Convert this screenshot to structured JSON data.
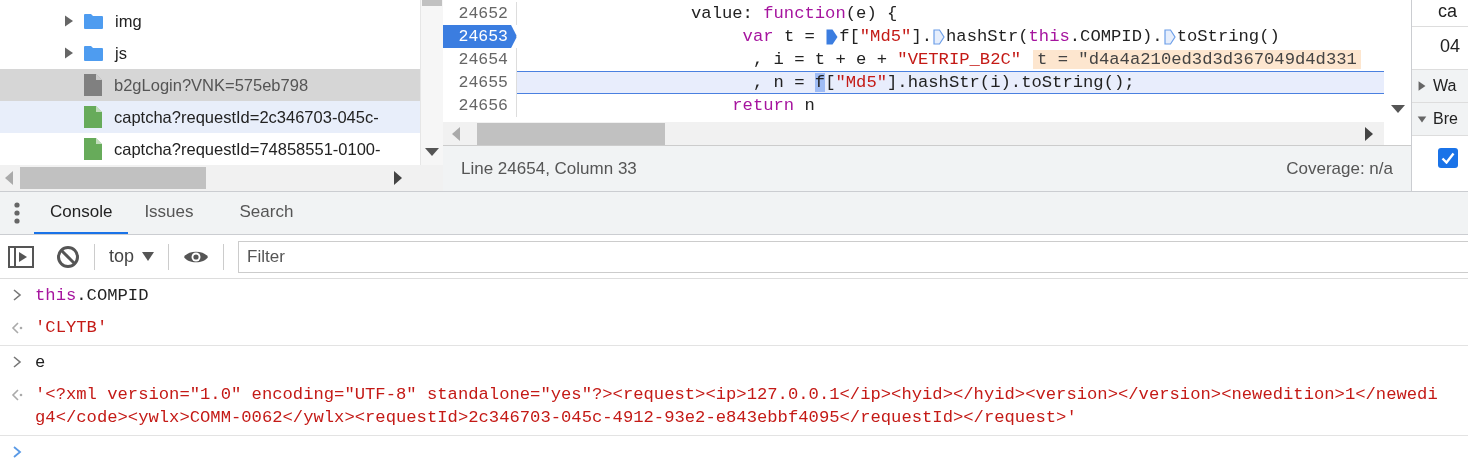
{
  "file_tree": {
    "items": [
      {
        "kind": "folder",
        "name": "img",
        "expanded": false,
        "selected": false,
        "hovered": false
      },
      {
        "kind": "folder",
        "name": "js",
        "expanded": false,
        "selected": false,
        "hovered": false
      },
      {
        "kind": "file",
        "name": "b2gLogin?VNK=575eb798",
        "color": "#808080",
        "selected": true,
        "hovered": false
      },
      {
        "kind": "file",
        "name": "captcha?requestId=2c346703-045c-",
        "color": "#67ab5a",
        "selected": false,
        "hovered": true
      },
      {
        "kind": "file",
        "name": "captcha?requestId=74858551-0100-",
        "color": "#67ab5a",
        "selected": false,
        "hovered": false
      }
    ]
  },
  "editor": {
    "lines": [
      {
        "number": "24652",
        "paused": false,
        "current": false,
        "tokens": [
          {
            "kind": "plain",
            "text": "                value: "
          },
          {
            "kind": "keyword",
            "text": "function"
          },
          {
            "kind": "plain",
            "text": "(e) {"
          }
        ]
      },
      {
        "number": "24653",
        "paused": true,
        "current": false,
        "tokens": [
          {
            "kind": "keyword",
            "text": "                     var"
          },
          {
            "kind": "plain",
            "text": " t = "
          },
          {
            "kind": "marker",
            "active": true
          },
          {
            "kind": "plain",
            "text": "f["
          },
          {
            "kind": "string",
            "text": "\"Md5\""
          },
          {
            "kind": "plain",
            "text": "]."
          },
          {
            "kind": "marker",
            "active": false
          },
          {
            "kind": "plain",
            "text": "hashStr("
          },
          {
            "kind": "keyword",
            "text": "this"
          },
          {
            "kind": "plain",
            "text": ".COMPID)."
          },
          {
            "kind": "marker",
            "active": false
          },
          {
            "kind": "plain",
            "text": "toString()"
          }
        ]
      },
      {
        "number": "24654",
        "paused": false,
        "current": false,
        "tokens": [
          {
            "kind": "plain",
            "text": "                      , i = t + e + "
          },
          {
            "kind": "string",
            "text": "\"VETRIP_B2C\""
          },
          {
            "kind": "inline-value",
            "text": "t = \"d4a4a210ed3d3d367049d4d331"
          }
        ]
      },
      {
        "number": "24655",
        "paused": false,
        "current": true,
        "tokens": [
          {
            "kind": "plain",
            "text": "                      , n = "
          },
          {
            "kind": "selection",
            "text": "f"
          },
          {
            "kind": "plain",
            "text": "["
          },
          {
            "kind": "string",
            "text": "\"Md5\""
          },
          {
            "kind": "plain",
            "text": "].hashStr(i).toString();"
          }
        ]
      },
      {
        "number": "24656",
        "paused": false,
        "current": false,
        "tokens": [
          {
            "kind": "keyword",
            "text": "                    return"
          },
          {
            "kind": "plain",
            "text": " n"
          }
        ]
      }
    ],
    "status": {
      "position": "Line 24654, Column 33",
      "coverage": "Coverage: n/a"
    }
  },
  "sidebar": {
    "rows": [
      "ca",
      "04"
    ],
    "sections": [
      {
        "label": "Wa",
        "expanded": false
      },
      {
        "label": "Bre",
        "expanded": true
      }
    ],
    "checkbox": {
      "checked": true
    }
  },
  "drawer": {
    "tabs": [
      {
        "label": "Console",
        "selected": true
      },
      {
        "label": "Issues",
        "selected": false
      },
      {
        "label": "Search",
        "selected": false
      }
    ],
    "context": "top",
    "filter": {
      "placeholder": "Filter"
    }
  },
  "console": {
    "entries": [
      {
        "kind": "input",
        "tokens": [
          {
            "kind": "keyword",
            "text": "this"
          },
          {
            "kind": "plain",
            "text": ".COMPID"
          }
        ]
      },
      {
        "kind": "result",
        "lines": [
          "'CLYTB'"
        ]
      },
      {
        "kind": "input",
        "tokens": [
          {
            "kind": "plain",
            "text": "e"
          }
        ]
      },
      {
        "kind": "result",
        "lines": [
          "'<?xml version=\"1.0\" encoding=\"UTF-8\" standalone=\"yes\"?><request><ip>127.0.0.1</ip><hyid></hyid><version></version><newedition>1</newedi",
          "g4</code><ywlx>COMM-0062</ywlx><requestId>2c346703-045c-4912-93e2-e843ebbf4095</requestId></request>'"
        ]
      },
      {
        "kind": "prompt"
      }
    ]
  }
}
